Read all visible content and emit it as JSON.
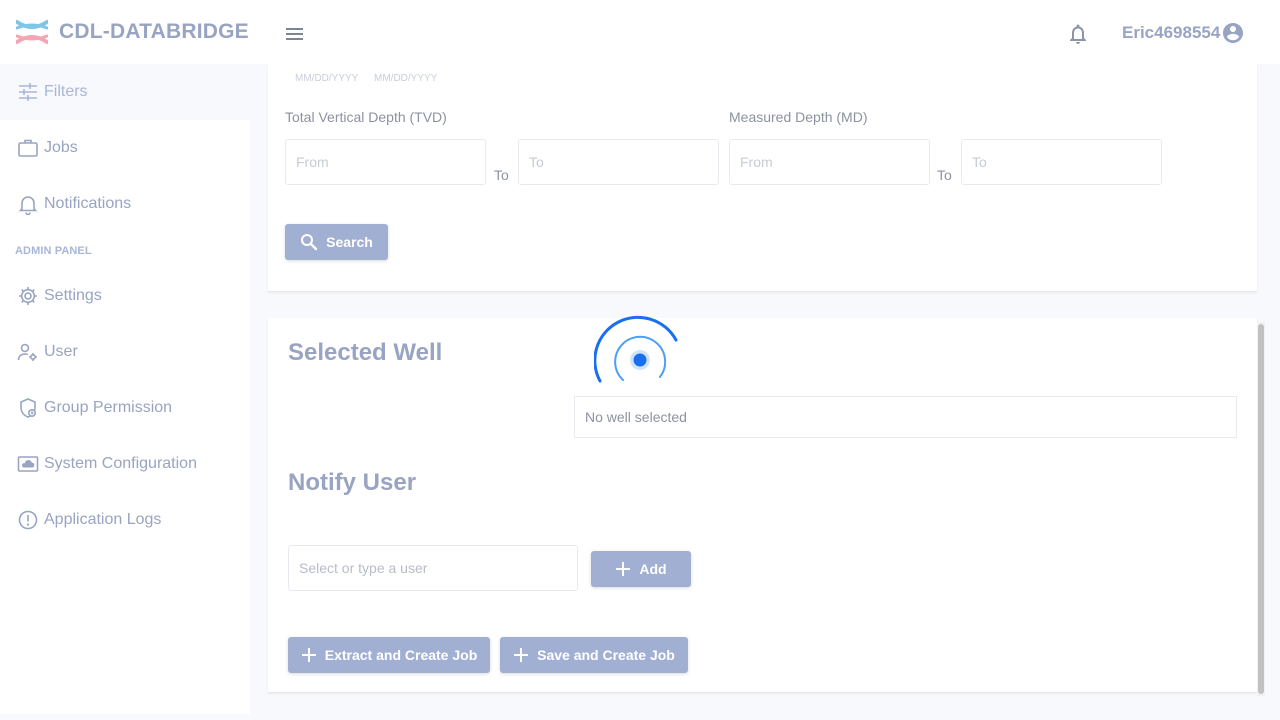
{
  "app": {
    "name": "CDL-DATABRIDGE",
    "colors": {
      "accent": "#a1b0d2",
      "logo_pink": "#f4a7b2",
      "logo_blue": "#7ec6e8",
      "spinner": "#1a6ff0"
    }
  },
  "header": {
    "menu_icon": "hamburger-icon",
    "bell_icon": "bell-icon",
    "user_name": "Eric4698554",
    "avatar_icon": "account-circle-icon"
  },
  "sidebar": {
    "items": [
      {
        "label": "Filters",
        "icon": "sliders-icon",
        "active": true
      },
      {
        "label": "Jobs",
        "icon": "briefcase-icon"
      },
      {
        "label": "Notifications",
        "icon": "bell-icon"
      }
    ],
    "admin_section": "ADMIN PANEL",
    "admin_items": [
      {
        "label": "Settings",
        "icon": "gear-icon"
      },
      {
        "label": "User",
        "icon": "user-gear-icon"
      },
      {
        "label": "Group Permission",
        "icon": "shield-icon"
      },
      {
        "label": "System Configuration",
        "icon": "cloud-monitor-icon"
      },
      {
        "label": "Application Logs",
        "icon": "alert-circle-icon"
      }
    ]
  },
  "filters": {
    "date_hint_1": "MM/DD/YYYY",
    "date_hint_2": "MM/DD/YYYY",
    "tvd": {
      "label": "Total Vertical Depth (TVD)",
      "from_placeholder": "From",
      "to_label": "To",
      "to_placeholder": "To"
    },
    "md": {
      "label": "Measured Depth (MD)",
      "from_placeholder": "From",
      "to_label": "To",
      "to_placeholder": "To"
    },
    "search_label": "Search"
  },
  "selected_well": {
    "heading": "Selected Well",
    "empty_text": "No well selected"
  },
  "notify": {
    "heading": "Notify User",
    "placeholder": "Select or type a user",
    "add_label": "Add"
  },
  "actions": {
    "extract_label": "Extract and Create Job",
    "save_label": "Save and Create Job"
  }
}
